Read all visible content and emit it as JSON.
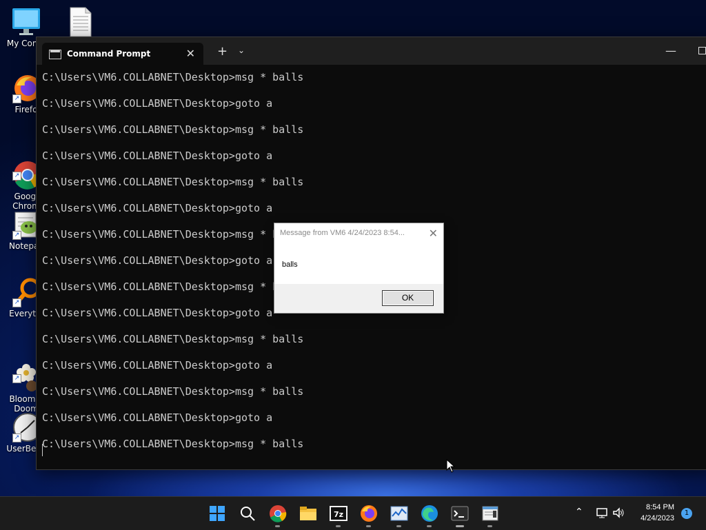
{
  "desktop": {
    "icons": [
      {
        "label": "My Comp",
        "icon": "computer-icon"
      },
      {
        "label": "",
        "icon": "text-file-icon"
      },
      {
        "label": "Firefo",
        "icon": "firefox-icon"
      },
      {
        "label": "Googl\nChrom",
        "icon": "chrome-icon"
      },
      {
        "label": "Notepac",
        "icon": "notepad-icon"
      },
      {
        "label": "Everythi",
        "icon": "search-magnifier-icon"
      },
      {
        "label": "Bloom a\nDoom",
        "icon": "flower-icon"
      },
      {
        "label": "UserBenc",
        "icon": "clock-gauge-icon"
      }
    ]
  },
  "terminal": {
    "tab_title": "Command Prompt",
    "lines": [
      "C:\\Users\\VM6.COLLABNET\\Desktop>msg * balls",
      "C:\\Users\\VM6.COLLABNET\\Desktop>goto a",
      "C:\\Users\\VM6.COLLABNET\\Desktop>msg * balls",
      "C:\\Users\\VM6.COLLABNET\\Desktop>goto a",
      "C:\\Users\\VM6.COLLABNET\\Desktop>msg * balls",
      "C:\\Users\\VM6.COLLABNET\\Desktop>goto a",
      "C:\\Users\\VM6.COLLABNET\\Desktop>msg * b",
      "C:\\Users\\VM6.COLLABNET\\Desktop>goto a",
      "C:\\Users\\VM6.COLLABNET\\Desktop>msg * b",
      "C:\\Users\\VM6.COLLABNET\\Desktop>goto a",
      "C:\\Users\\VM6.COLLABNET\\Desktop>msg * balls",
      "C:\\Users\\VM6.COLLABNET\\Desktop>goto a",
      "C:\\Users\\VM6.COLLABNET\\Desktop>msg * balls",
      "C:\\Users\\VM6.COLLABNET\\Desktop>goto a",
      "C:\\Users\\VM6.COLLABNET\\Desktop>msg * balls"
    ]
  },
  "message_box": {
    "title": "Message from VM6 4/24/2023 8:54...",
    "text": "balls",
    "ok_label": "OK"
  },
  "taskbar": {
    "apps": [
      "start-icon",
      "search-icon",
      "chrome-icon",
      "file-explorer-icon",
      "7zip-icon",
      "firefox-icon",
      "task-manager-icon",
      "edge-icon",
      "terminal-icon",
      "notepad-icon"
    ],
    "app_7zip_label": "7z",
    "time": "8:54 PM",
    "date": "4/24/2023",
    "notification_count": "1"
  },
  "colors": {
    "terminal_bg": "#0c0c0c",
    "terminal_text": "#cccccc",
    "taskbar_bg": "#1c1c1c"
  }
}
